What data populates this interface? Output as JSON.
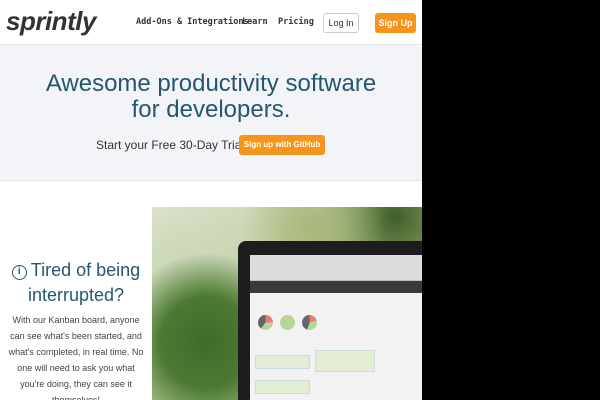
{
  "nav": {
    "logo": "sprintly",
    "links": [
      "Add-Ons & Integrations",
      "Learn",
      "Pricing"
    ],
    "login": "Log In",
    "signup": "Sign Up"
  },
  "hero": {
    "headline": "Awesome productivity software for developers.",
    "trial_text": "Start your Free 30-Day Trial:",
    "github_button": "Sign up with GitHub"
  },
  "feature": {
    "icon": "info-icon",
    "title": "Tired of being interrupted?",
    "body": "With our Kanban board, anyone can see what's been started, and what's completed, in real time. No one will need to ask you what you're doing, they can see it themselves!"
  },
  "colors": {
    "accent": "#f7941d",
    "heading": "#255770"
  }
}
